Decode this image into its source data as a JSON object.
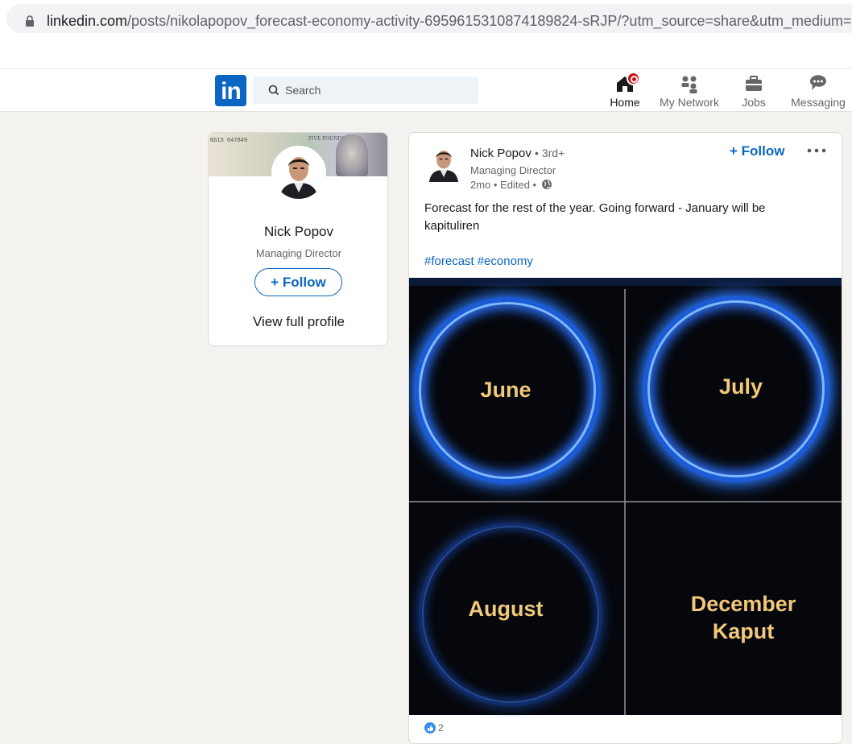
{
  "browser": {
    "url_domain": "linkedin.com",
    "url_path": "/posts/nikolapopov_forecast-economy-activity-6959615310874189824-sRJP/?utm_source=share&utm_medium=mem"
  },
  "nav": {
    "search_placeholder": "Search",
    "logo_text": "in",
    "items": [
      {
        "label": "Home",
        "icon": "home-icon",
        "active": true
      },
      {
        "label": "My Network",
        "icon": "network-icon"
      },
      {
        "label": "Jobs",
        "icon": "briefcase-icon"
      },
      {
        "label": "Messaging",
        "icon": "messaging-icon"
      }
    ]
  },
  "profile_card": {
    "banner_serial": "NS15 047849",
    "banner_note": "FIVE POUNDS",
    "name": "Nick Popov",
    "title": "Managing Director",
    "follow_label": "+ Follow",
    "view_profile_label": "View full profile"
  },
  "post": {
    "author_name": "Nick Popov",
    "degree": "• 3rd+",
    "author_title": "Managing Director",
    "meta": "2mo • Edited •",
    "follow_label": "+ Follow",
    "text": "Forecast for the rest of the year. Going forward - January will be kapituliren",
    "hashtags": [
      "#forecast",
      "#economy"
    ],
    "image_labels": {
      "june": "June",
      "july": "July",
      "august": "August",
      "december_line1": "December",
      "december_line2": "Kaput"
    },
    "reaction_count": "2"
  },
  "colors": {
    "linkedin_blue": "#0a66c2",
    "page_bg": "#f3f2ef",
    "notification_red": "#cc1016",
    "month_text": "#f2c879"
  }
}
